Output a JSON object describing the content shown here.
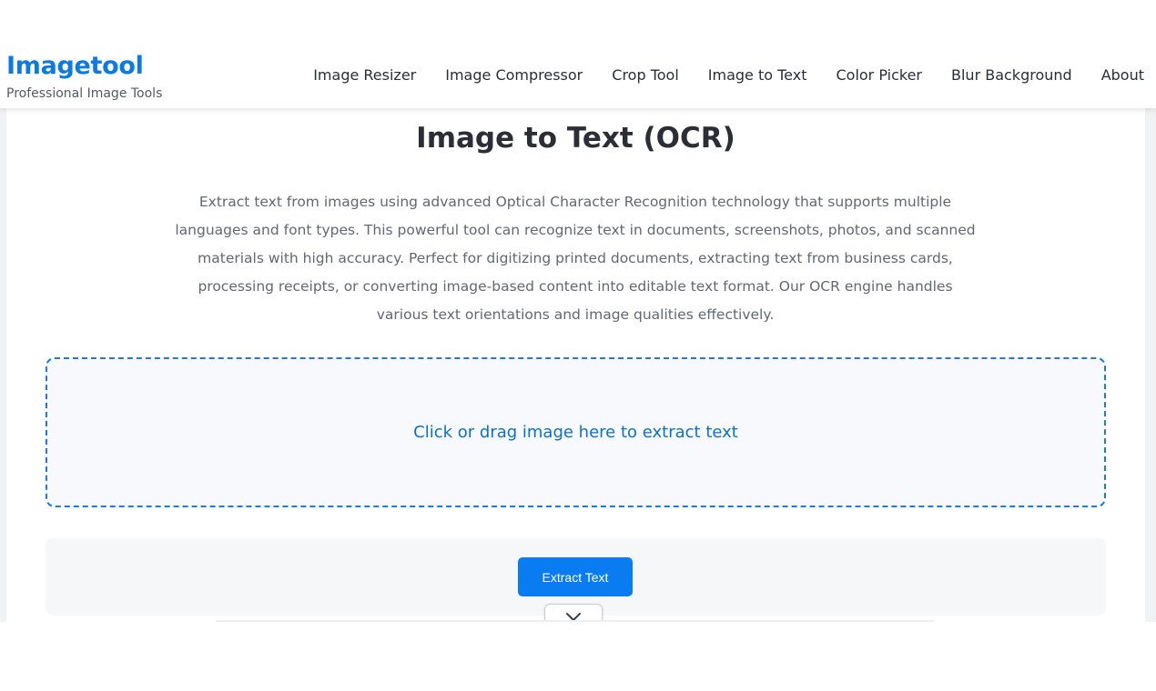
{
  "brand": {
    "title": "Imagetool",
    "subtitle": "Professional Image Tools",
    "accent_color": "#0a7ae6"
  },
  "nav": {
    "items": [
      {
        "label": "Image Resizer"
      },
      {
        "label": "Image Compressor"
      },
      {
        "label": "Crop Tool"
      },
      {
        "label": "Image to Text"
      },
      {
        "label": "Color Picker"
      },
      {
        "label": "Blur Background"
      },
      {
        "label": "About"
      }
    ]
  },
  "main": {
    "title": "Image to Text (OCR)",
    "description": "Extract text from images using advanced Optical Character Recognition technology that supports multiple languages and font types. This powerful tool can recognize text in documents, screenshots, photos, and scanned materials with high accuracy. Perfect for digitizing printed documents, extracting text from business cards, processing receipts, or converting image-based content into editable text format. Our OCR engine handles various text orientations and image qualities effectively.",
    "dropzone_text": "Click or drag image here to extract text",
    "extract_button_label": "Extract Text",
    "expand_icon": "chevron-down-icon",
    "button_color": "#0a7cf2",
    "dropzone_border_color": "#1a7ddc"
  }
}
